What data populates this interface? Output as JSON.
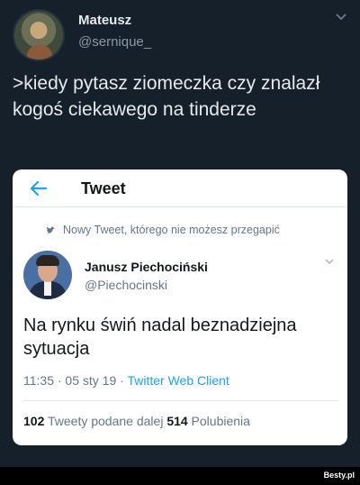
{
  "outer_tweet": {
    "author_name": "Mateusz",
    "author_handle": "@sernique_",
    "text": ">kiedy pytasz ziomeczka czy znalazł kogoś ciekawego na tinderze"
  },
  "embedded": {
    "topbar_title": "Tweet",
    "promo_text": "Nowy Tweet, którego nie możesz przegapić",
    "author_name": "Janusz Piechociński",
    "author_handle": "@Piechocinski",
    "text": "Na rynku świń nadal beznadziejna sytuacja",
    "meta_time": "11:35 · 05 sty 19 · ",
    "meta_client": "Twitter Web Client",
    "retweets_count": "102",
    "retweets_label": " Tweety podane dalej  ",
    "likes_count": "514",
    "likes_label": " Polubienia"
  },
  "footer": {
    "brand": "Besty.pl"
  },
  "colors": {
    "background": "#15202b",
    "link": "#1da1f2",
    "card": "#ffffff"
  },
  "icons": [
    "chevron-down-icon",
    "back-arrow-icon",
    "promo-bird-icon",
    "chevron-down-icon"
  ]
}
